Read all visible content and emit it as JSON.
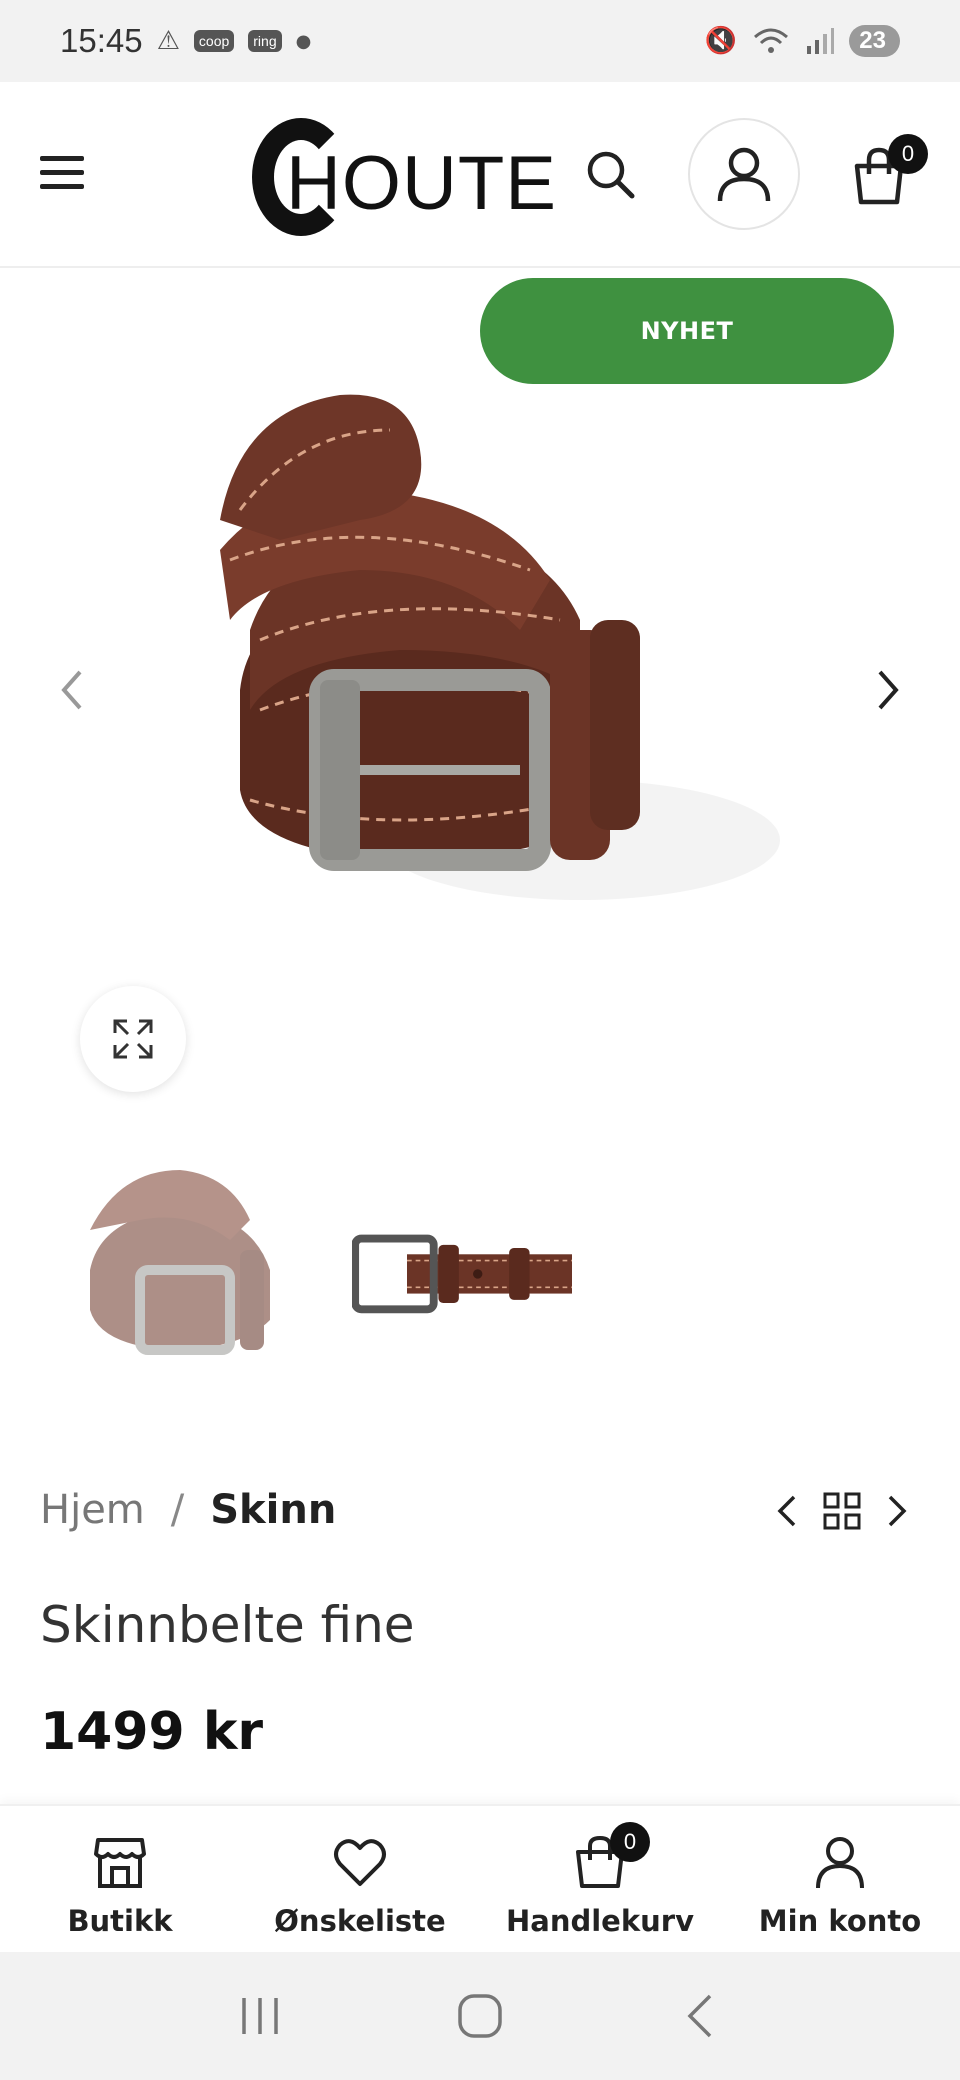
{
  "status_bar": {
    "time": "15:45",
    "notification_labels": [
      "coop",
      "ring"
    ],
    "battery": "23"
  },
  "header": {
    "logo_text": "HOUTE",
    "cart_count": "0"
  },
  "gallery": {
    "badge": "NYHET"
  },
  "breadcrumb": {
    "home": "Hjem",
    "separator": "/",
    "current": "Skinn"
  },
  "product": {
    "title": "Skinnbelte fine",
    "price": "1499 kr"
  },
  "bottom_nav": {
    "items": [
      {
        "label": "Butikk",
        "icon": "store-icon"
      },
      {
        "label": "Ønskeliste",
        "icon": "heart-icon"
      },
      {
        "label": "Handlekurv",
        "icon": "bag-icon"
      },
      {
        "label": "Min konto",
        "icon": "user-icon"
      }
    ],
    "cart_count": "0"
  },
  "colors": {
    "badge_green": "#3f9140",
    "leather_brown": "#6b3426",
    "buckle_silver": "#9a9a96"
  }
}
